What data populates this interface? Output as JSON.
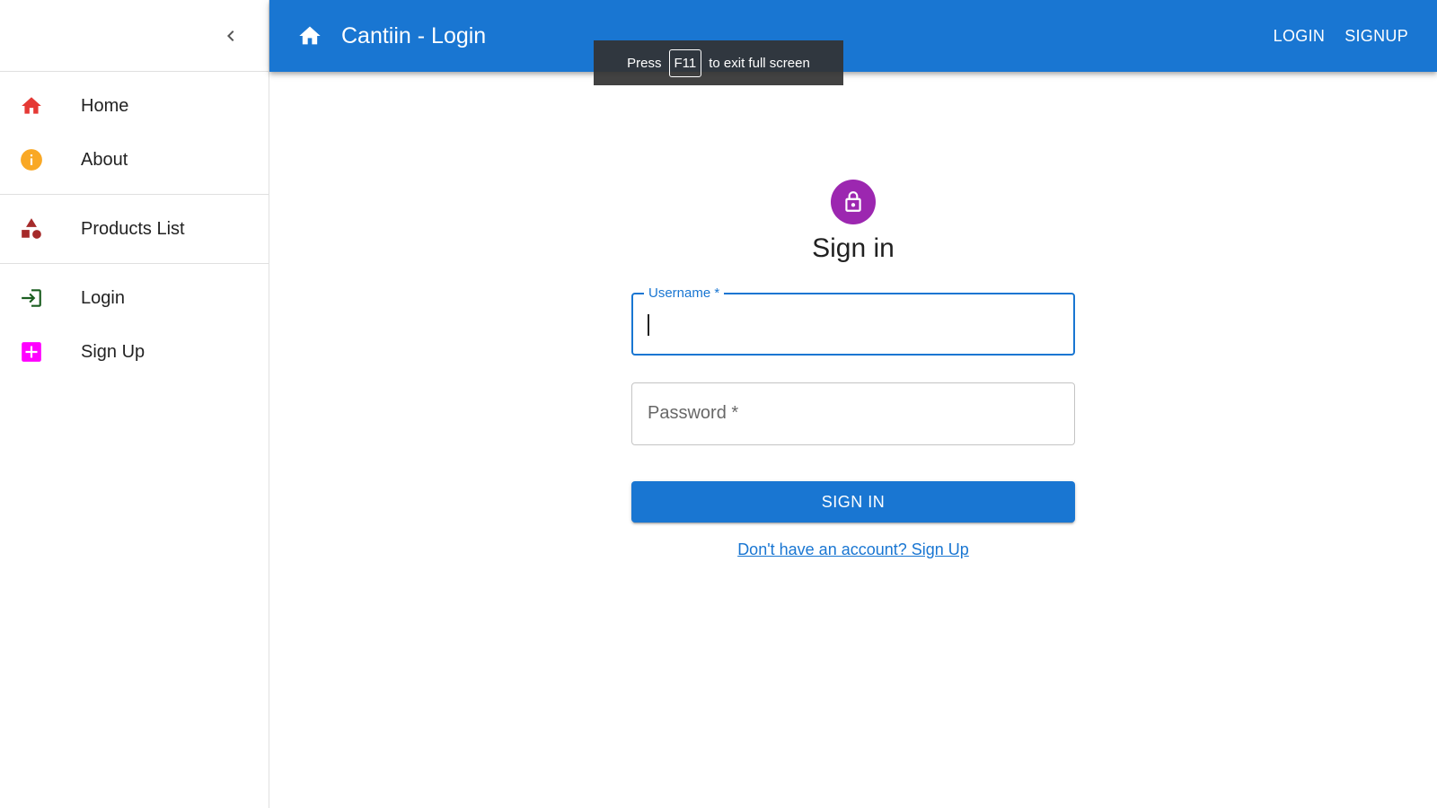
{
  "app": {
    "title": "Cantiin - Login"
  },
  "header": {
    "actions": [
      "LOGIN",
      "SIGNUP"
    ]
  },
  "fullscreen_notice": {
    "prefix": "Press",
    "key": "F11",
    "suffix": "to exit full screen"
  },
  "sidebar": {
    "groups": [
      [
        {
          "label": "Home",
          "icon": "home-icon",
          "color": "#e53935"
        },
        {
          "label": "About",
          "icon": "info-icon",
          "color": "#f9a825"
        }
      ],
      [
        {
          "label": "Products List",
          "icon": "category-icon",
          "color": "#a52a2a"
        }
      ],
      [
        {
          "label": "Login",
          "icon": "login-icon",
          "color": "#1b5e20"
        },
        {
          "label": "Sign Up",
          "icon": "add-box-icon",
          "color": "#ff00ff"
        }
      ]
    ]
  },
  "form": {
    "heading": "Sign in",
    "username": {
      "label": "Username *",
      "value": ""
    },
    "password": {
      "label": "Password *",
      "value": ""
    },
    "submit_label": "SIGN IN",
    "signup_link": "Don't have an account? Sign Up"
  },
  "colors": {
    "primary": "#1976d2",
    "avatar": "#9c27b0"
  }
}
